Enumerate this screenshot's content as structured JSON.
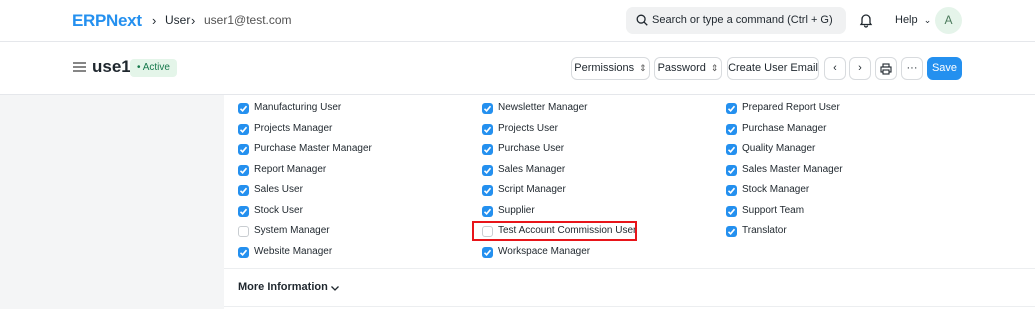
{
  "navbar": {
    "logo": "ERPNext",
    "breadcrumbs": [
      {
        "label": "User"
      },
      {
        "label": "user1@test.com"
      }
    ],
    "search_placeholder": "Search or type a command (Ctrl + G)",
    "help_label": "Help",
    "avatar_initial": "A"
  },
  "page": {
    "title": "use1",
    "status": "Active",
    "buttons": {
      "permissions": "Permissions",
      "password": "Password",
      "create_email": "Create User Email",
      "save": "Save",
      "more": "···"
    }
  },
  "roles": [
    {
      "label": "Manufacturing User",
      "checked": true
    },
    {
      "label": "Newsletter Manager",
      "checked": true
    },
    {
      "label": "Prepared Report User",
      "checked": true
    },
    {
      "label": "Projects Manager",
      "checked": true
    },
    {
      "label": "Projects User",
      "checked": true
    },
    {
      "label": "Purchase Manager",
      "checked": true
    },
    {
      "label": "Purchase Master Manager",
      "checked": true
    },
    {
      "label": "Purchase User",
      "checked": true
    },
    {
      "label": "Quality Manager",
      "checked": true
    },
    {
      "label": "Report Manager",
      "checked": true
    },
    {
      "label": "Sales Manager",
      "checked": true
    },
    {
      "label": "Sales Master Manager",
      "checked": true
    },
    {
      "label": "Sales User",
      "checked": true
    },
    {
      "label": "Script Manager",
      "checked": true
    },
    {
      "label": "Stock Manager",
      "checked": true
    },
    {
      "label": "Stock User",
      "checked": true
    },
    {
      "label": "Supplier",
      "checked": true
    },
    {
      "label": "Support Team",
      "checked": true
    },
    {
      "label": "System Manager",
      "checked": false
    },
    {
      "label": "Test Account Commission User",
      "checked": false
    },
    {
      "label": "Translator",
      "checked": true
    },
    {
      "label": "Website Manager",
      "checked": true
    },
    {
      "label": "Workspace Manager",
      "checked": true
    }
  ],
  "section": {
    "more_info": "More Information"
  },
  "colors": {
    "accent": "#2490ef",
    "highlight": "#e8151a"
  }
}
